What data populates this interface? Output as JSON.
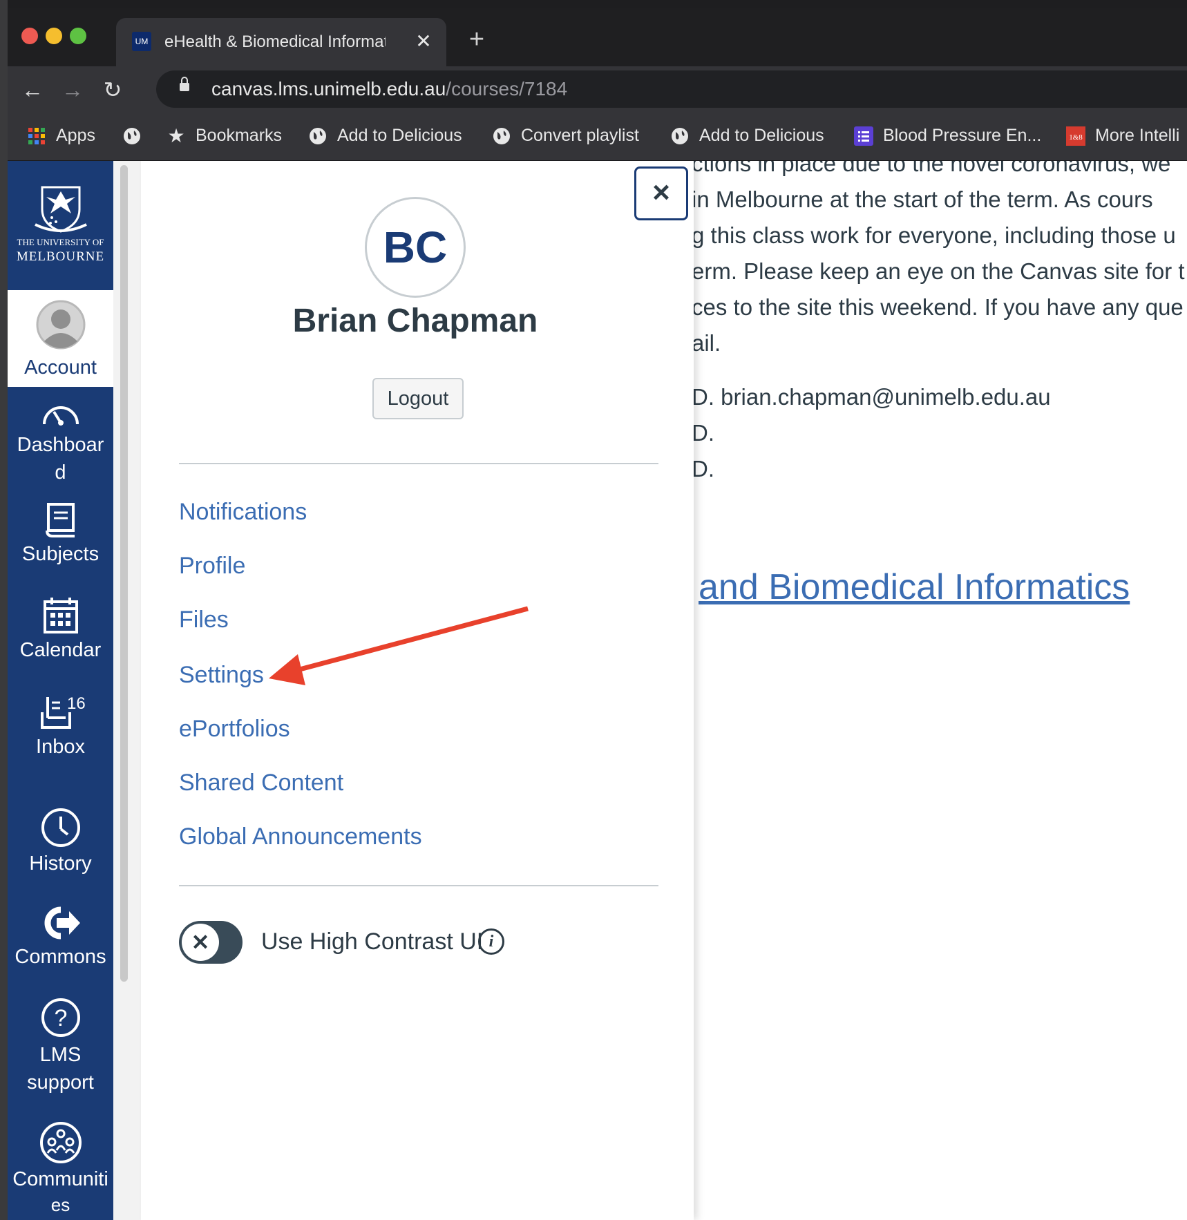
{
  "browser": {
    "tab_title": "eHealth & Biomedical Informatics",
    "tab_favicon_text": "UM",
    "url_host": "canvas.lms.unimelb.edu.au",
    "url_path": "/courses/7184",
    "bookmarks": [
      {
        "label": "Apps",
        "icon": "apps-grid-icon"
      },
      {
        "label": "",
        "icon": "globe-icon"
      },
      {
        "label": "Bookmarks",
        "icon": "star-icon"
      },
      {
        "label": "Add to Delicious",
        "icon": "globe-icon"
      },
      {
        "label": "Convert playlist",
        "icon": "globe-icon"
      },
      {
        "label": "Add to Delicious",
        "icon": "globe-icon"
      },
      {
        "label": "Blood Pressure En...",
        "icon": "list-icon"
      },
      {
        "label": "More Intelli",
        "icon": "site-icon"
      }
    ],
    "colors": {
      "traffic_red": "#ee5a52",
      "traffic_yellow": "#f5be2e",
      "traffic_green": "#5ec243"
    }
  },
  "global_nav": {
    "logo_line1": "THE UNIVERSITY OF",
    "logo_line2": "MELBOURNE",
    "items": [
      {
        "label": "Account",
        "icon": "avatar-icon",
        "active": true
      },
      {
        "label": "Dashboar",
        "label2": "d",
        "icon": "dashboard-icon"
      },
      {
        "label": "Subjects",
        "icon": "book-icon"
      },
      {
        "label": "Calendar",
        "icon": "calendar-icon"
      },
      {
        "label": "Inbox",
        "icon": "inbox-icon",
        "badge": "16"
      },
      {
        "label": "History",
        "icon": "clock-icon"
      },
      {
        "label": "Commons",
        "icon": "commons-icon"
      },
      {
        "label": "LMS",
        "label2": "support",
        "icon": "help-icon"
      },
      {
        "label": "Communiti",
        "label2": "es",
        "icon": "communities-icon"
      }
    ]
  },
  "tray": {
    "avatar_initials": "BC",
    "user_name": "Brian Chapman",
    "logout_label": "Logout",
    "links": [
      "Notifications",
      "Profile",
      "Files",
      "Settings",
      "ePortfolios",
      "Shared Content",
      "Global Announcements"
    ],
    "high_contrast_label": "Use High Contrast UI",
    "high_contrast_on": false,
    "close_label": "×"
  },
  "course_page": {
    "lines": [
      "ctions in place due to the novel coronavirus, we",
      " in Melbourne at the start of the term. As cours",
      "g this class work for everyone, including those u",
      "erm. Please keep an eye on the Canvas site for t",
      "ces to the site this weekend. If you have any que",
      "ail.",
      "",
      "D. brian.chapman@unimelb.edu.au",
      "D.",
      "D."
    ],
    "heading_link": " and Biomedical Informatics"
  },
  "annotation": {
    "arrow_color": "#e8412c",
    "points_to": "Settings"
  }
}
